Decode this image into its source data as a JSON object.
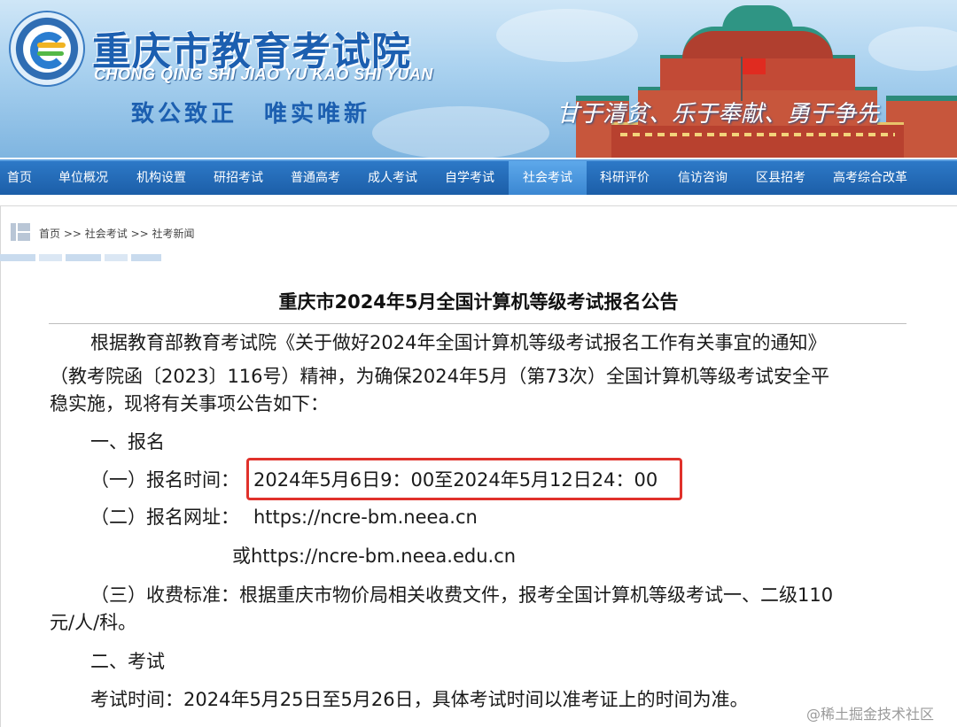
{
  "header": {
    "title": "重庆市教育考试院",
    "pinyin": "CHONG QING SHI JIAO YU KAO SHI YUAN",
    "motto": "致公致正　唯实唯新",
    "slogan": "甘于清贫、乐于奉献、勇于争先"
  },
  "nav": {
    "items": [
      {
        "label": "首页"
      },
      {
        "label": "单位概况"
      },
      {
        "label": "机构设置"
      },
      {
        "label": "研招考试"
      },
      {
        "label": "普通高考"
      },
      {
        "label": "成人考试"
      },
      {
        "label": "自学考试"
      },
      {
        "label": "社会考试",
        "active": true
      },
      {
        "label": "科研评价"
      },
      {
        "label": "信访咨询"
      },
      {
        "label": "区县招考"
      },
      {
        "label": "高考综合改革"
      }
    ]
  },
  "breadcrumb": {
    "home": "首页",
    "sep1": " >> ",
    "section": "社会考试",
    "sep2": " >> ",
    "current": "社考新闻"
  },
  "article": {
    "title": "重庆市2024年5月全国计算机等级考试报名公告",
    "intro_line1": "根据教育部教育考试院《关于做好2024年全国计算机等级考试报名工作有关事宜的通知》",
    "intro_line2": "（教考院函〔2023〕116号）精神，为确保2024年5月（第73次）全国计算机等级考试安全平",
    "intro_line3": "稳实施，现将有关事项公告如下：",
    "section1": "一、报名",
    "reg_time_label": "（一）报名时间：",
    "reg_time_value": "2024年5月6日9：00至2024年5月12日24：00",
    "reg_url_label": "（二）报名网址：",
    "reg_url1": "https://ncre-bm.neea.cn",
    "reg_url2": "或https://ncre-bm.neea.edu.cn",
    "fee_line1": "（三）收费标准：根据重庆市物价局相关收费文件，报考全国计算机等级考试一、二级110",
    "fee_line2": "元/人/科。",
    "section2": "二、考试",
    "exam_time": "考试时间：2024年5月25日至5月26日，具体考试时间以准考证上的时间为准。"
  },
  "watermark": "@稀土掘金技术社区",
  "colors": {
    "nav_bg": "#1c5ea8",
    "nav_active": "#3b87d2",
    "title_blue": "#1c5fb0",
    "highlight": "#e0312b"
  }
}
